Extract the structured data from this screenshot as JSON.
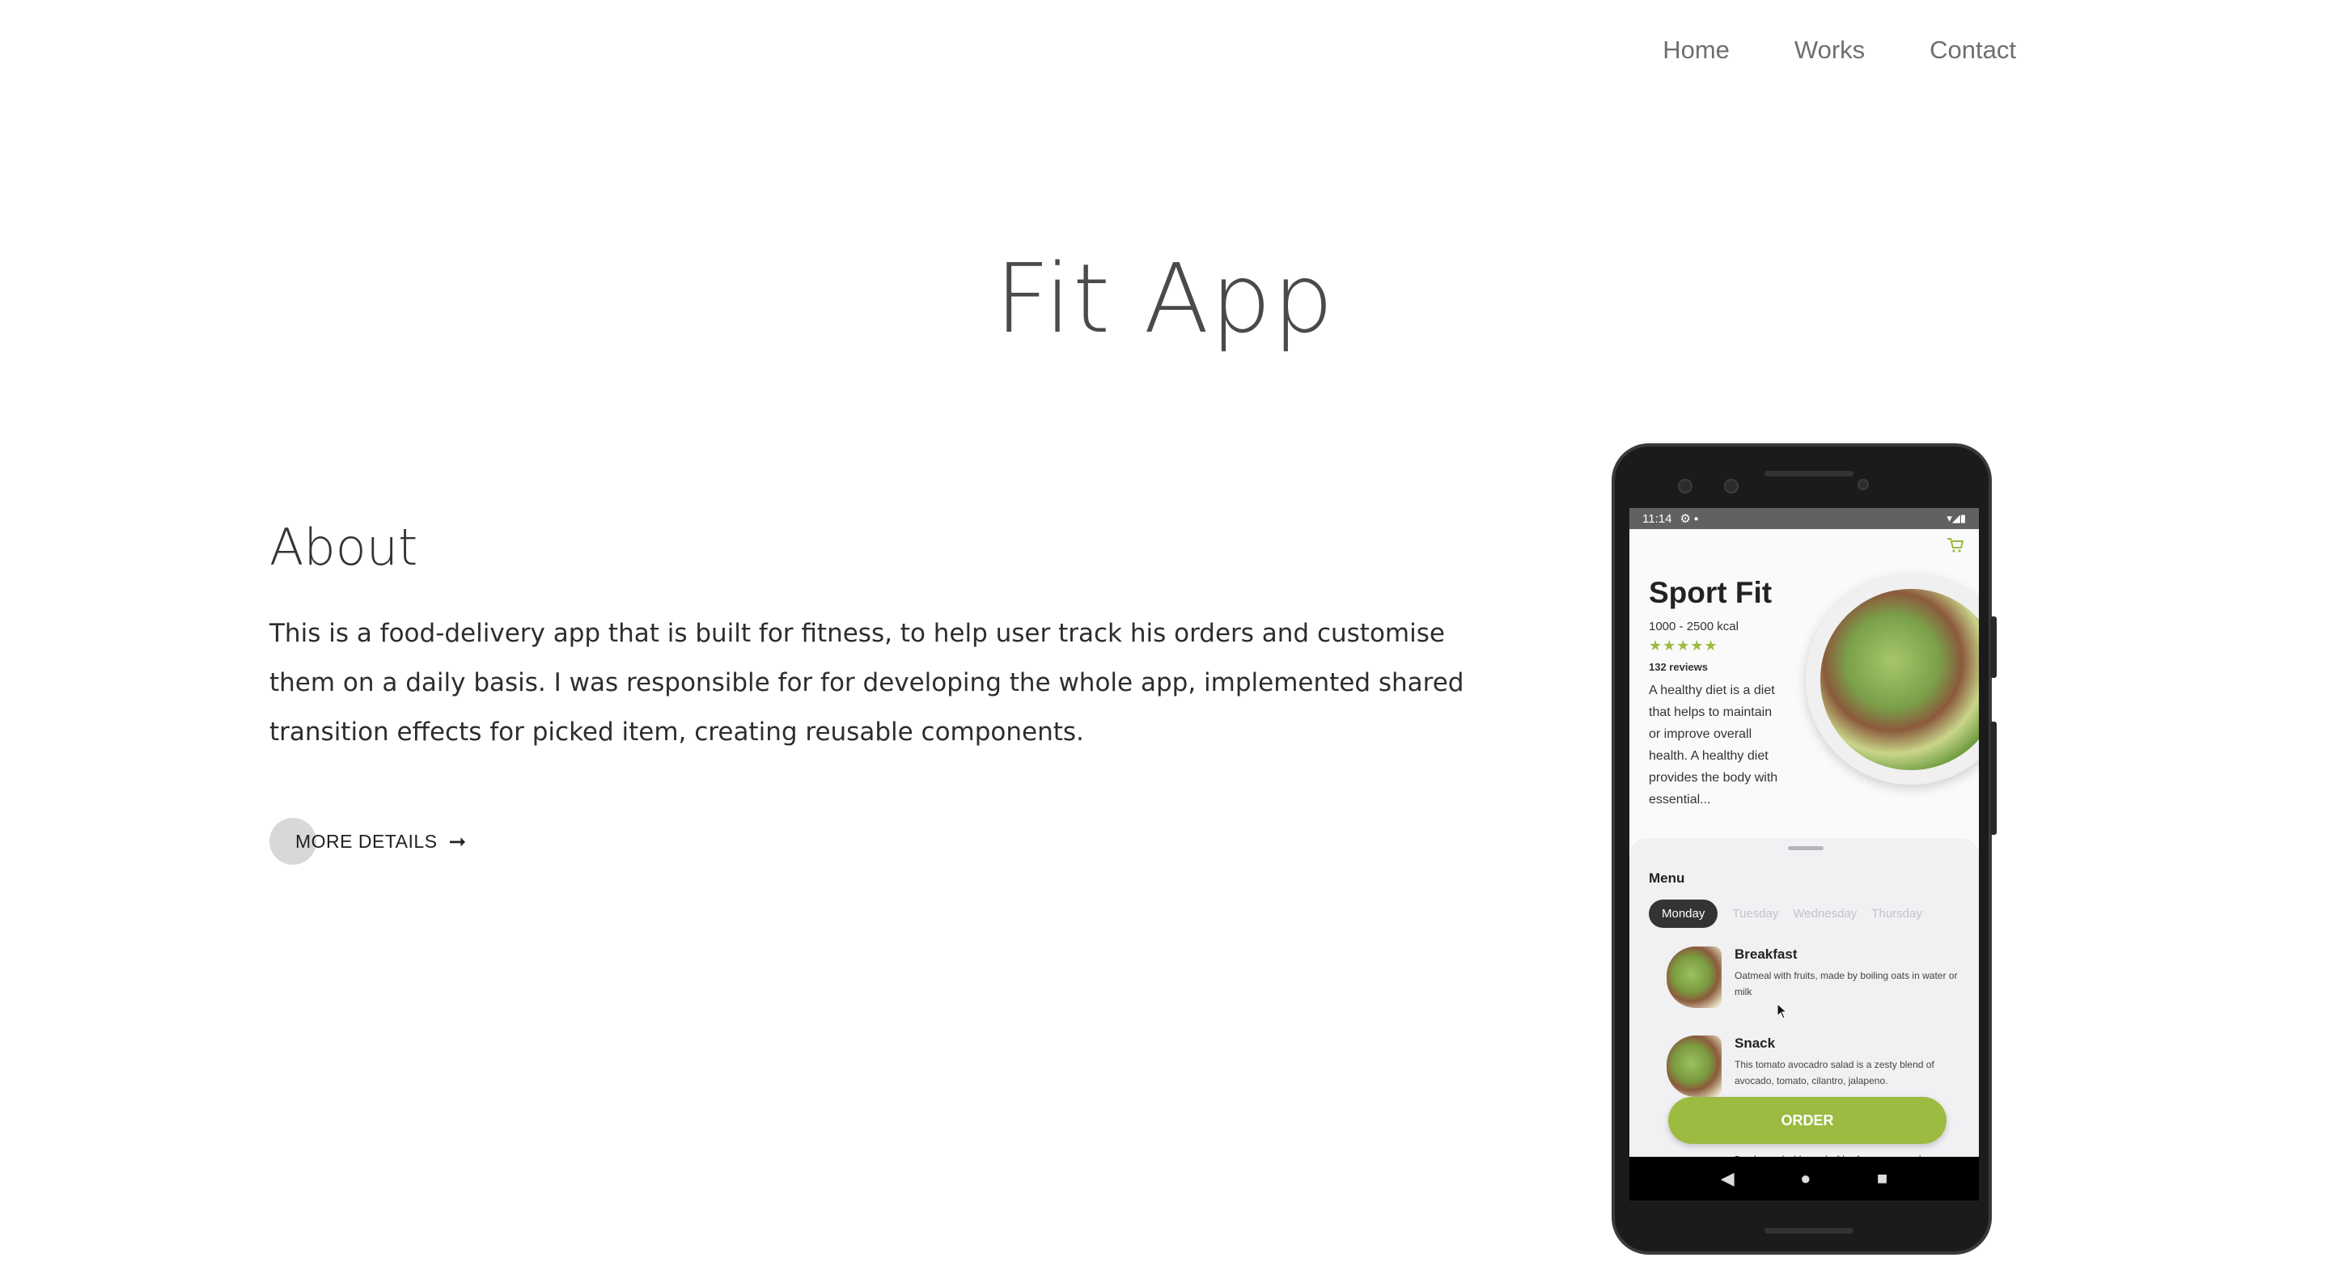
{
  "nav": {
    "items": [
      "Home",
      "Works",
      "Contact"
    ]
  },
  "page": {
    "title": "Fit App"
  },
  "about": {
    "heading": "About",
    "body": "This is a food-delivery app that is built for fitness, to help user track his orders and customise them on a daily basis. I was responsible for for developing the whole app, implemented shared transition effects for picked item, creating reusable components.",
    "more_label": "MORE DETAILS",
    "more_arrow": "➞"
  },
  "phone": {
    "status": {
      "time": "11:14",
      "left_icons": "⚙ ▪",
      "right_icons": "▾◢▮"
    },
    "cart_icon": "🛒",
    "app_name": "Sport Fit",
    "kcal": "1000 - 2500 kcal",
    "stars": "★★★★★",
    "reviews": "132 reviews",
    "description": "A healthy diet is a diet that helps to maintain or improve overall health. A healthy diet provides the body with essential...",
    "menu": {
      "heading": "Menu",
      "days": [
        "Monday",
        "Tuesday",
        "Wednesday",
        "Thursday"
      ],
      "active_day": "Monday",
      "items": [
        {
          "name": "Breakfast",
          "desc": "Oatmeal with fruits, made by boiling oats in water or milk"
        },
        {
          "name": "Snack",
          "desc": "This tomato avocadro salad is a zesty blend of avocado, tomato, cilantro, jalapeno."
        }
      ],
      "next_item_desc": "Garden salad based of leafy greens such as"
    },
    "order_label": "ORDER",
    "nav_icons": {
      "back": "◀",
      "home": "●",
      "recents": "■"
    }
  },
  "colors": {
    "accent": "#9bbb41",
    "text": "#2d2d2d",
    "muted": "#6f6f6f"
  }
}
